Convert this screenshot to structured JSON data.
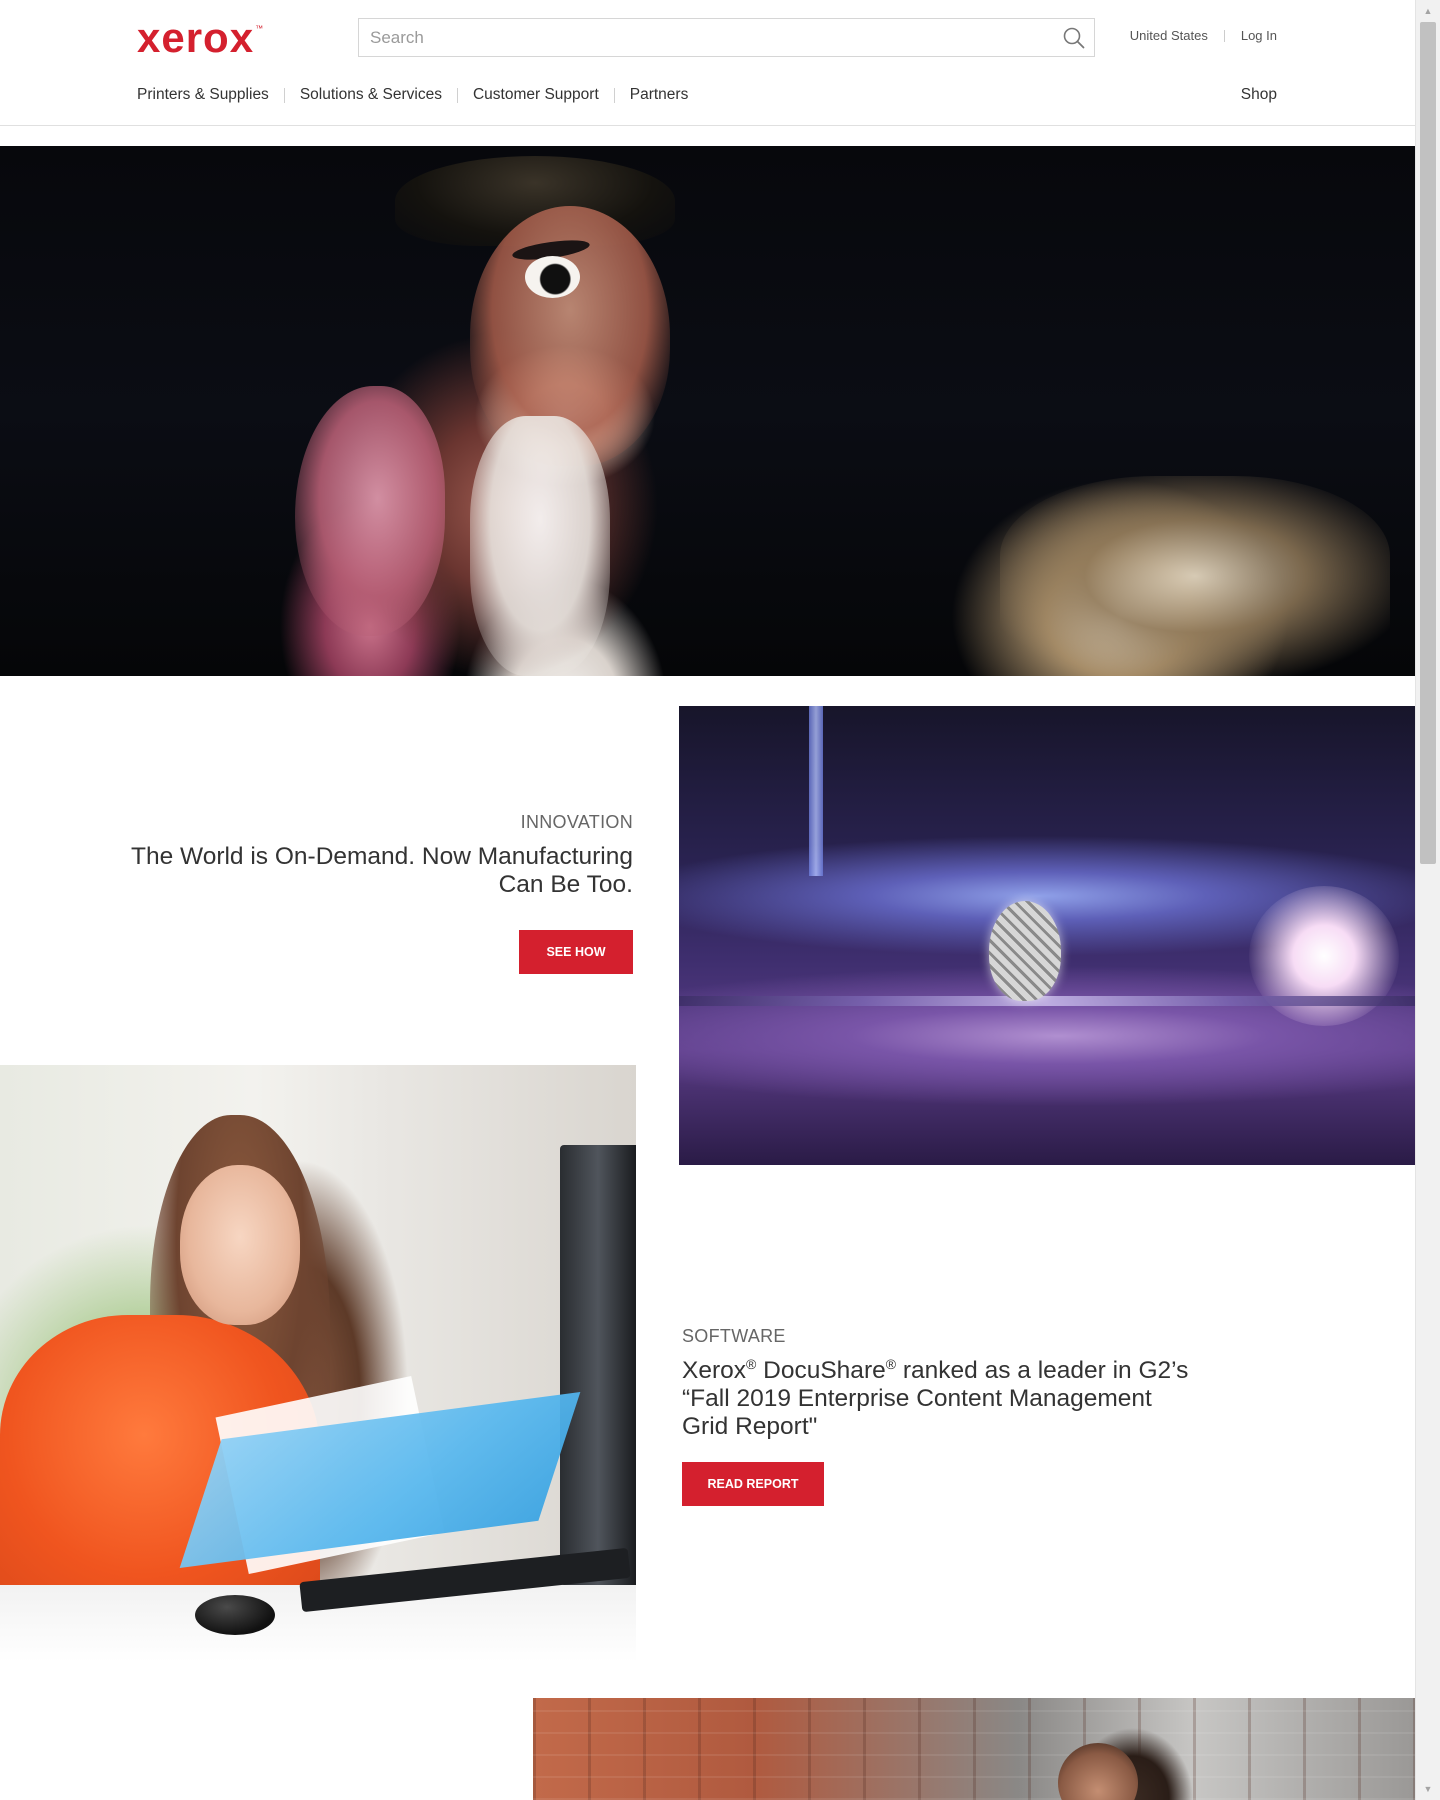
{
  "brand": {
    "logo_text": "xerox",
    "logo_tm": "™",
    "accent_color": "#d4202e"
  },
  "header": {
    "search": {
      "placeholder": "Search",
      "value": "",
      "icon": "search-icon"
    },
    "utility": {
      "region": "United States",
      "login": "Log In"
    },
    "nav": {
      "items": [
        {
          "label": "Printers & Supplies"
        },
        {
          "label": "Solutions & Services"
        },
        {
          "label": "Customer Support"
        },
        {
          "label": "Partners"
        }
      ],
      "shop": "Shop"
    }
  },
  "innovation": {
    "eyebrow": "INNOVATION",
    "title": "The World is On-Demand. Now Manufacturing Can Be Too.",
    "button": "SEE HOW"
  },
  "software": {
    "eyebrow": "SOFTWARE",
    "title_part1": "Xerox",
    "reg_mark": "®",
    "title_part2": " DocuShare",
    "title_part3": " ranked as a leader in G2’s “Fall 2019 Enterprise Content Management Grid Report\"",
    "button": "READ REPORT"
  }
}
